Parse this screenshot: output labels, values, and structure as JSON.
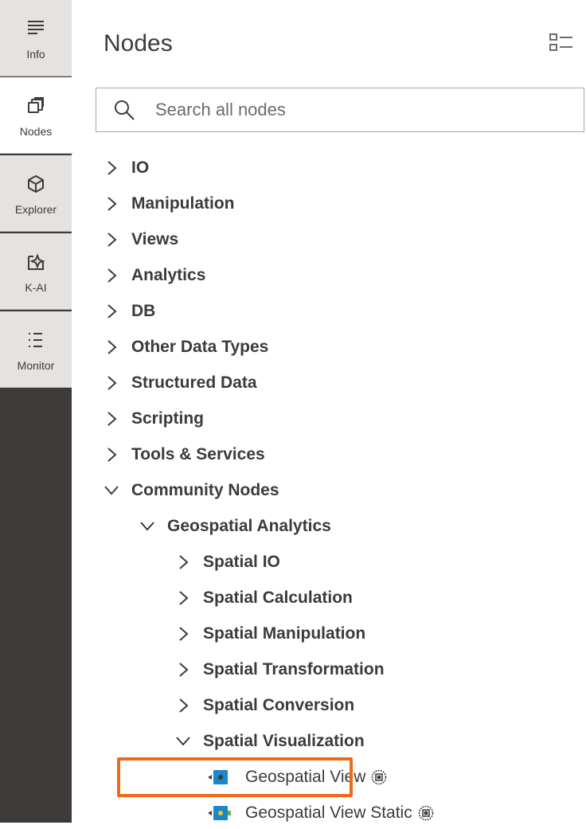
{
  "rail": {
    "items": [
      {
        "label": "Info",
        "icon": "info-lines-icon"
      },
      {
        "label": "Nodes",
        "icon": "nodes-icon",
        "active": true
      },
      {
        "label": "Explorer",
        "icon": "explorer-cube-icon"
      },
      {
        "label": "K-AI",
        "icon": "k-ai-sparkle-icon"
      },
      {
        "label": "Monitor",
        "icon": "monitor-list-icon"
      }
    ]
  },
  "panel": {
    "title": "Nodes",
    "search_placeholder": "Search all nodes"
  },
  "tree": [
    {
      "label": "IO",
      "expanded": false
    },
    {
      "label": "Manipulation",
      "expanded": false
    },
    {
      "label": "Views",
      "expanded": false
    },
    {
      "label": "Analytics",
      "expanded": false
    },
    {
      "label": "DB",
      "expanded": false
    },
    {
      "label": "Other Data Types",
      "expanded": false
    },
    {
      "label": "Structured Data",
      "expanded": false
    },
    {
      "label": "Scripting",
      "expanded": false
    },
    {
      "label": "Tools & Services",
      "expanded": false
    },
    {
      "label": "Community Nodes",
      "expanded": true
    },
    {
      "label": "Geospatial Analytics",
      "expanded": true
    },
    {
      "label": "Spatial IO",
      "expanded": false
    },
    {
      "label": "Spatial Calculation",
      "expanded": false
    },
    {
      "label": "Spatial Manipulation",
      "expanded": false
    },
    {
      "label": "Spatial Transformation",
      "expanded": false
    },
    {
      "label": "Spatial Conversion",
      "expanded": false
    },
    {
      "label": "Spatial Visualization",
      "expanded": true
    }
  ],
  "nodes": [
    {
      "label": "Geospatial View",
      "highlighted": true
    },
    {
      "label": "Geospatial View Static",
      "highlighted": false
    }
  ],
  "colors": {
    "rail_bg": "#3e3a39",
    "rail_item_bg": "#e4e3e1",
    "highlight": "#f06b18",
    "node_view_blue": "#1a87c8",
    "node_port_green": "#6ab04c"
  }
}
